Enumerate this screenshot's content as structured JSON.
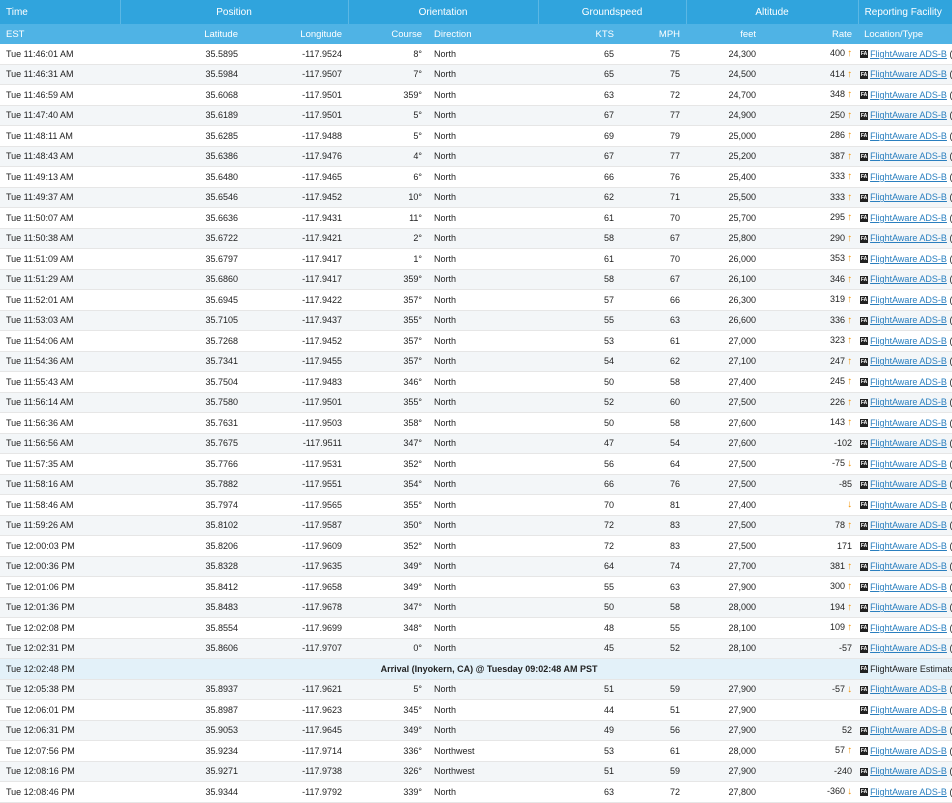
{
  "header": {
    "group": {
      "time": "Time",
      "position": "Position",
      "orientation": "Orientation",
      "groundspeed": "Groundspeed",
      "altitude": "Altitude",
      "facility": "Reporting Facility"
    },
    "columns": {
      "est": "EST",
      "latitude": "Latitude",
      "longitude": "Longitude",
      "course": "Course",
      "direction": "Direction",
      "kts": "KTS",
      "mph": "MPH",
      "feet": "feet",
      "rate": "Rate",
      "location": "Location/Type"
    }
  },
  "source_name": "FlightAware ADS-B",
  "badge": "FA",
  "rows": [
    {
      "time": "Tue 11:46:01 AM",
      "lat": "35.5895",
      "lon": "-117.9524",
      "course": "8°",
      "dir": "North",
      "kts": "65",
      "mph": "75",
      "feet": "24,300",
      "rate": "400",
      "arrow": "up",
      "code": "(KIYK)"
    },
    {
      "time": "Tue 11:46:31 AM",
      "lat": "35.5984",
      "lon": "-117.9507",
      "course": "7°",
      "dir": "North",
      "kts": "65",
      "mph": "75",
      "feet": "24,500",
      "rate": "414",
      "arrow": "up",
      "code": "(KIYK)"
    },
    {
      "time": "Tue 11:46:59 AM",
      "lat": "35.6068",
      "lon": "-117.9501",
      "course": "359°",
      "dir": "North",
      "kts": "63",
      "mph": "72",
      "feet": "24,700",
      "rate": "348",
      "arrow": "up",
      "code": "(KMHV)"
    },
    {
      "time": "Tue 11:47:40 AM",
      "lat": "35.6189",
      "lon": "-117.9501",
      "course": "5°",
      "dir": "North",
      "kts": "67",
      "mph": "77",
      "feet": "24,900",
      "rate": "250",
      "arrow": "up",
      "code": "(KMHV)"
    },
    {
      "time": "Tue 11:48:11 AM",
      "lat": "35.6285",
      "lon": "-117.9488",
      "course": "5°",
      "dir": "North",
      "kts": "69",
      "mph": "79",
      "feet": "25,000",
      "rate": "286",
      "arrow": "up",
      "code": "(KIYK)"
    },
    {
      "time": "Tue 11:48:43 AM",
      "lat": "35.6386",
      "lon": "-117.9476",
      "course": "4°",
      "dir": "North",
      "kts": "67",
      "mph": "77",
      "feet": "25,200",
      "rate": "387",
      "arrow": "up",
      "code": "(KMHV)"
    },
    {
      "time": "Tue 11:49:13 AM",
      "lat": "35.6480",
      "lon": "-117.9465",
      "course": "6°",
      "dir": "North",
      "kts": "66",
      "mph": "76",
      "feet": "25,400",
      "rate": "333",
      "arrow": "up",
      "code": "(KWJF)"
    },
    {
      "time": "Tue 11:49:37 AM",
      "lat": "35.6546",
      "lon": "-117.9452",
      "course": "10°",
      "dir": "North",
      "kts": "62",
      "mph": "71",
      "feet": "25,500",
      "rate": "333",
      "arrow": "up",
      "code": "(KMHV)"
    },
    {
      "time": "Tue 11:50:07 AM",
      "lat": "35.6636",
      "lon": "-117.9431",
      "course": "11°",
      "dir": "North",
      "kts": "61",
      "mph": "70",
      "feet": "25,700",
      "rate": "295",
      "arrow": "up",
      "code": "(KMHV)"
    },
    {
      "time": "Tue 11:50:38 AM",
      "lat": "35.6722",
      "lon": "-117.9421",
      "course": "2°",
      "dir": "North",
      "kts": "58",
      "mph": "67",
      "feet": "25,800",
      "rate": "290",
      "arrow": "up",
      "code": "(KMHV)"
    },
    {
      "time": "Tue 11:51:09 AM",
      "lat": "35.6797",
      "lon": "-117.9417",
      "course": "1°",
      "dir": "North",
      "kts": "61",
      "mph": "70",
      "feet": "26,000",
      "rate": "353",
      "arrow": "up",
      "code": "(KMHV)"
    },
    {
      "time": "Tue 11:51:29 AM",
      "lat": "35.6860",
      "lon": "-117.9417",
      "course": "359°",
      "dir": "North",
      "kts": "58",
      "mph": "67",
      "feet": "26,100",
      "rate": "346",
      "arrow": "up",
      "code": "(KMHV)"
    },
    {
      "time": "Tue 11:52:01 AM",
      "lat": "35.6945",
      "lon": "-117.9422",
      "course": "357°",
      "dir": "North",
      "kts": "57",
      "mph": "66",
      "feet": "26,300",
      "rate": "319",
      "arrow": "up",
      "code": "(KIYK)"
    },
    {
      "time": "Tue 11:53:03 AM",
      "lat": "35.7105",
      "lon": "-117.9437",
      "course": "355°",
      "dir": "North",
      "kts": "55",
      "mph": "63",
      "feet": "26,600",
      "rate": "336",
      "arrow": "up",
      "code": "(KIYK)"
    },
    {
      "time": "Tue 11:54:06 AM",
      "lat": "35.7268",
      "lon": "-117.9452",
      "course": "357°",
      "dir": "North",
      "kts": "53",
      "mph": "61",
      "feet": "27,000",
      "rate": "323",
      "arrow": "up",
      "code": "(KMHV)"
    },
    {
      "time": "Tue 11:54:36 AM",
      "lat": "35.7341",
      "lon": "-117.9455",
      "course": "357°",
      "dir": "North",
      "kts": "54",
      "mph": "62",
      "feet": "27,100",
      "rate": "247",
      "arrow": "up",
      "code": "(KIYK)"
    },
    {
      "time": "Tue 11:55:43 AM",
      "lat": "35.7504",
      "lon": "-117.9483",
      "course": "346°",
      "dir": "North",
      "kts": "50",
      "mph": "58",
      "feet": "27,400",
      "rate": "245",
      "arrow": "up",
      "code": "(KMHV)"
    },
    {
      "time": "Tue 11:56:14 AM",
      "lat": "35.7580",
      "lon": "-117.9501",
      "course": "355°",
      "dir": "North",
      "kts": "52",
      "mph": "60",
      "feet": "27,500",
      "rate": "226",
      "arrow": "up",
      "code": "(KMHV)"
    },
    {
      "time": "Tue 11:56:36 AM",
      "lat": "35.7631",
      "lon": "-117.9503",
      "course": "358°",
      "dir": "North",
      "kts": "50",
      "mph": "58",
      "feet": "27,600",
      "rate": "143",
      "arrow": "up",
      "code": "(KIYK)"
    },
    {
      "time": "Tue 11:56:56 AM",
      "lat": "35.7675",
      "lon": "-117.9511",
      "course": "347°",
      "dir": "North",
      "kts": "47",
      "mph": "54",
      "feet": "27,600",
      "rate": "-102",
      "arrow": "",
      "code": "(KIYK)"
    },
    {
      "time": "Tue 11:57:35 AM",
      "lat": "35.7766",
      "lon": "-117.9531",
      "course": "352°",
      "dir": "North",
      "kts": "56",
      "mph": "64",
      "feet": "27,500",
      "rate": "-75",
      "arrow": "down",
      "code": "(KMHV)"
    },
    {
      "time": "Tue 11:58:16 AM",
      "lat": "35.7882",
      "lon": "-117.9551",
      "course": "354°",
      "dir": "North",
      "kts": "66",
      "mph": "76",
      "feet": "27,500",
      "rate": "-85",
      "arrow": "",
      "code": "(KIYK)"
    },
    {
      "time": "Tue 11:58:46 AM",
      "lat": "35.7974",
      "lon": "-117.9565",
      "course": "355°",
      "dir": "North",
      "kts": "70",
      "mph": "81",
      "feet": "27,400",
      "rate": "",
      "arrow": "down",
      "code": "(KIYK)"
    },
    {
      "time": "Tue 11:59:26 AM",
      "lat": "35.8102",
      "lon": "-117.9587",
      "course": "350°",
      "dir": "North",
      "kts": "72",
      "mph": "83",
      "feet": "27,500",
      "rate": "78",
      "arrow": "up",
      "code": "(KIYK)"
    },
    {
      "time": "Tue 12:00:03 PM",
      "lat": "35.8206",
      "lon": "-117.9609",
      "course": "352°",
      "dir": "North",
      "kts": "72",
      "mph": "83",
      "feet": "27,500",
      "rate": "171",
      "arrow": "",
      "code": "(KSBA)"
    },
    {
      "time": "Tue 12:00:36 PM",
      "lat": "35.8328",
      "lon": "-117.9635",
      "course": "349°",
      "dir": "North",
      "kts": "64",
      "mph": "74",
      "feet": "27,700",
      "rate": "381",
      "arrow": "up",
      "code": "(KMHV)"
    },
    {
      "time": "Tue 12:01:06 PM",
      "lat": "35.8412",
      "lon": "-117.9658",
      "course": "349°",
      "dir": "North",
      "kts": "55",
      "mph": "63",
      "feet": "27,900",
      "rate": "300",
      "arrow": "up",
      "code": "(KMHV)"
    },
    {
      "time": "Tue 12:01:36 PM",
      "lat": "35.8483",
      "lon": "-117.9678",
      "course": "347°",
      "dir": "North",
      "kts": "50",
      "mph": "58",
      "feet": "28,000",
      "rate": "194",
      "arrow": "up",
      "code": "(KMHV)"
    },
    {
      "time": "Tue 12:02:08 PM",
      "lat": "35.8554",
      "lon": "-117.9699",
      "course": "348°",
      "dir": "North",
      "kts": "48",
      "mph": "55",
      "feet": "28,100",
      "rate": "109",
      "arrow": "up",
      "code": "(KIYK)"
    },
    {
      "time": "Tue 12:02:31 PM",
      "lat": "35.8606",
      "lon": "-117.9707",
      "course": "0°",
      "dir": "North",
      "kts": "45",
      "mph": "52",
      "feet": "28,100",
      "rate": "-57",
      "arrow": "",
      "code": "(KIYK)"
    }
  ],
  "arrival": {
    "time": "Tue 12:02:48 PM",
    "text": "Arrival (Inyokern, CA) @ Tuesday 09:02:48 AM PST",
    "facility": "FlightAware Estimated"
  },
  "rows2": [
    {
      "time": "Tue 12:05:38 PM",
      "lat": "35.8937",
      "lon": "-117.9621",
      "course": "5°",
      "dir": "North",
      "kts": "51",
      "mph": "59",
      "feet": "27,900",
      "rate": "-57",
      "arrow": "down",
      "code": "(KMHV)"
    },
    {
      "time": "Tue 12:06:01 PM",
      "lat": "35.8987",
      "lon": "-117.9623",
      "course": "345°",
      "dir": "North",
      "kts": "44",
      "mph": "51",
      "feet": "27,900",
      "rate": "",
      "arrow": "",
      "code": "(KIYK)"
    },
    {
      "time": "Tue 12:06:31 PM",
      "lat": "35.9053",
      "lon": "-117.9645",
      "course": "349°",
      "dir": "North",
      "kts": "49",
      "mph": "56",
      "feet": "27,900",
      "rate": "52",
      "arrow": "",
      "code": "(KIYK)"
    },
    {
      "time": "Tue 12:07:56 PM",
      "lat": "35.9234",
      "lon": "-117.9714",
      "course": "336°",
      "dir": "Northwest",
      "kts": "53",
      "mph": "61",
      "feet": "28,000",
      "rate": "57",
      "arrow": "up",
      "code": "(KIYK)"
    },
    {
      "time": "Tue 12:08:16 PM",
      "lat": "35.9271",
      "lon": "-117.9738",
      "course": "326°",
      "dir": "Northwest",
      "kts": "51",
      "mph": "59",
      "feet": "27,900",
      "rate": "-240",
      "arrow": "",
      "code": "(KIYK)"
    },
    {
      "time": "Tue 12:08:46 PM",
      "lat": "35.9344",
      "lon": "-117.9792",
      "course": "339°",
      "dir": "North",
      "kts": "63",
      "mph": "72",
      "feet": "27,800",
      "rate": "-360",
      "arrow": "down",
      "code": "(KMHV)"
    }
  ]
}
